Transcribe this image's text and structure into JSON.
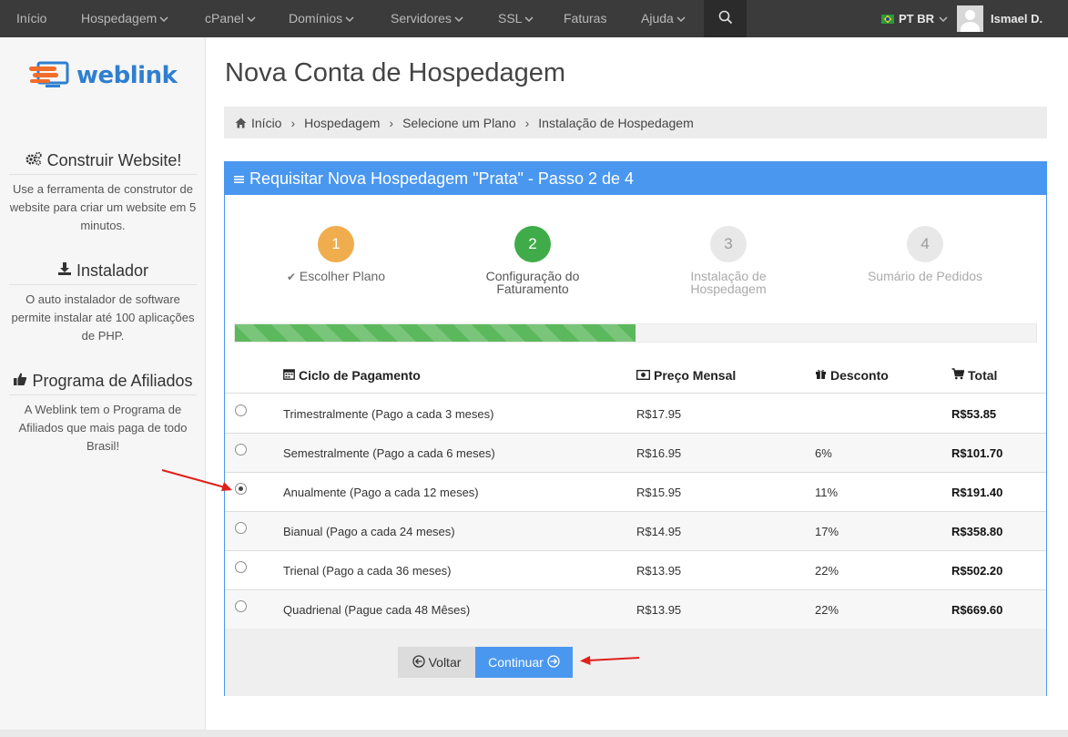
{
  "nav": {
    "items": [
      {
        "label": "Início",
        "has_caret": false
      },
      {
        "label": "Hospedagem",
        "has_caret": true
      },
      {
        "label": "cPanel",
        "has_caret": true
      },
      {
        "label": "Domínios",
        "has_caret": true
      },
      {
        "label": "Servidores",
        "has_caret": true
      },
      {
        "label": "SSL",
        "has_caret": true
      },
      {
        "label": "Faturas",
        "has_caret": false
      },
      {
        "label": "Ajuda",
        "has_caret": true
      }
    ],
    "language": "PT BR",
    "user_name": "Ismael D."
  },
  "sidebar": {
    "logo_text": "weblink",
    "sections": [
      {
        "title": "Construir Website!",
        "icon": "gears-icon",
        "text": "Use a ferramenta de construtor de website para criar um website em 5 minutos."
      },
      {
        "title": "Instalador",
        "icon": "download-icon",
        "text": "O auto instalador de software permite instalar até 100 aplicações de PHP."
      },
      {
        "title": "Programa de Afiliados",
        "icon": "thumbs-up-icon",
        "text": "A Weblink tem o Programa de Afiliados que mais paga de todo Brasil!"
      }
    ]
  },
  "page": {
    "title": "Nova Conta de Hospedagem",
    "breadcrumb": [
      "Início",
      "Hospedagem",
      "Selecione um Plano",
      "Instalação de Hospedagem"
    ]
  },
  "panel": {
    "heading": "Requisitar Nova Hospedagem \"Prata\" - Passo 2 de 4",
    "steps": [
      {
        "number": "1",
        "label": "Escolher Plano",
        "state": "done"
      },
      {
        "number": "2",
        "label": "Configuração do Faturamento",
        "state": "active"
      },
      {
        "number": "3",
        "label": "Instalação de Hospedagem",
        "state": "pending"
      },
      {
        "number": "4",
        "label": "Sumário de Pedidos",
        "state": "pending"
      }
    ],
    "progress_fraction": 0.5,
    "columns": {
      "cycle": "Ciclo de Pagamento",
      "monthly": "Preço Mensal",
      "discount": "Desconto",
      "total": "Total"
    },
    "rows": [
      {
        "cycle": "Trimestralmente (Pago a cada 3 meses)",
        "monthly": "R$17.95",
        "discount": "",
        "total": "R$53.85",
        "selected": false
      },
      {
        "cycle": "Semestralmente (Pago a cada 6 meses)",
        "monthly": "R$16.95",
        "discount": "6%",
        "total": "R$101.70",
        "selected": false
      },
      {
        "cycle": "Anualmente (Pago a cada 12 meses)",
        "monthly": "R$15.95",
        "discount": "11%",
        "total": "R$191.40",
        "selected": true
      },
      {
        "cycle": "Bianual (Pago a cada 24 meses)",
        "monthly": "R$14.95",
        "discount": "17%",
        "total": "R$358.80",
        "selected": false
      },
      {
        "cycle": "Trienal (Pago a cada 36 meses)",
        "monthly": "R$13.95",
        "discount": "22%",
        "total": "R$502.20",
        "selected": false
      },
      {
        "cycle": "Quadrienal (Pague cada 48 Mêses)",
        "monthly": "R$13.95",
        "discount": "22%",
        "total": "R$669.60",
        "selected": false
      }
    ],
    "back_label": "Voltar",
    "continue_label": "Continuar"
  },
  "colors": {
    "topbar": "#3b3b3b",
    "accent": "#4a97f0",
    "step_done": "#f0ad4e",
    "step_active": "#3fac49",
    "step_pending": "#e8e8e8",
    "annotation_arrow": "#e0201b"
  }
}
